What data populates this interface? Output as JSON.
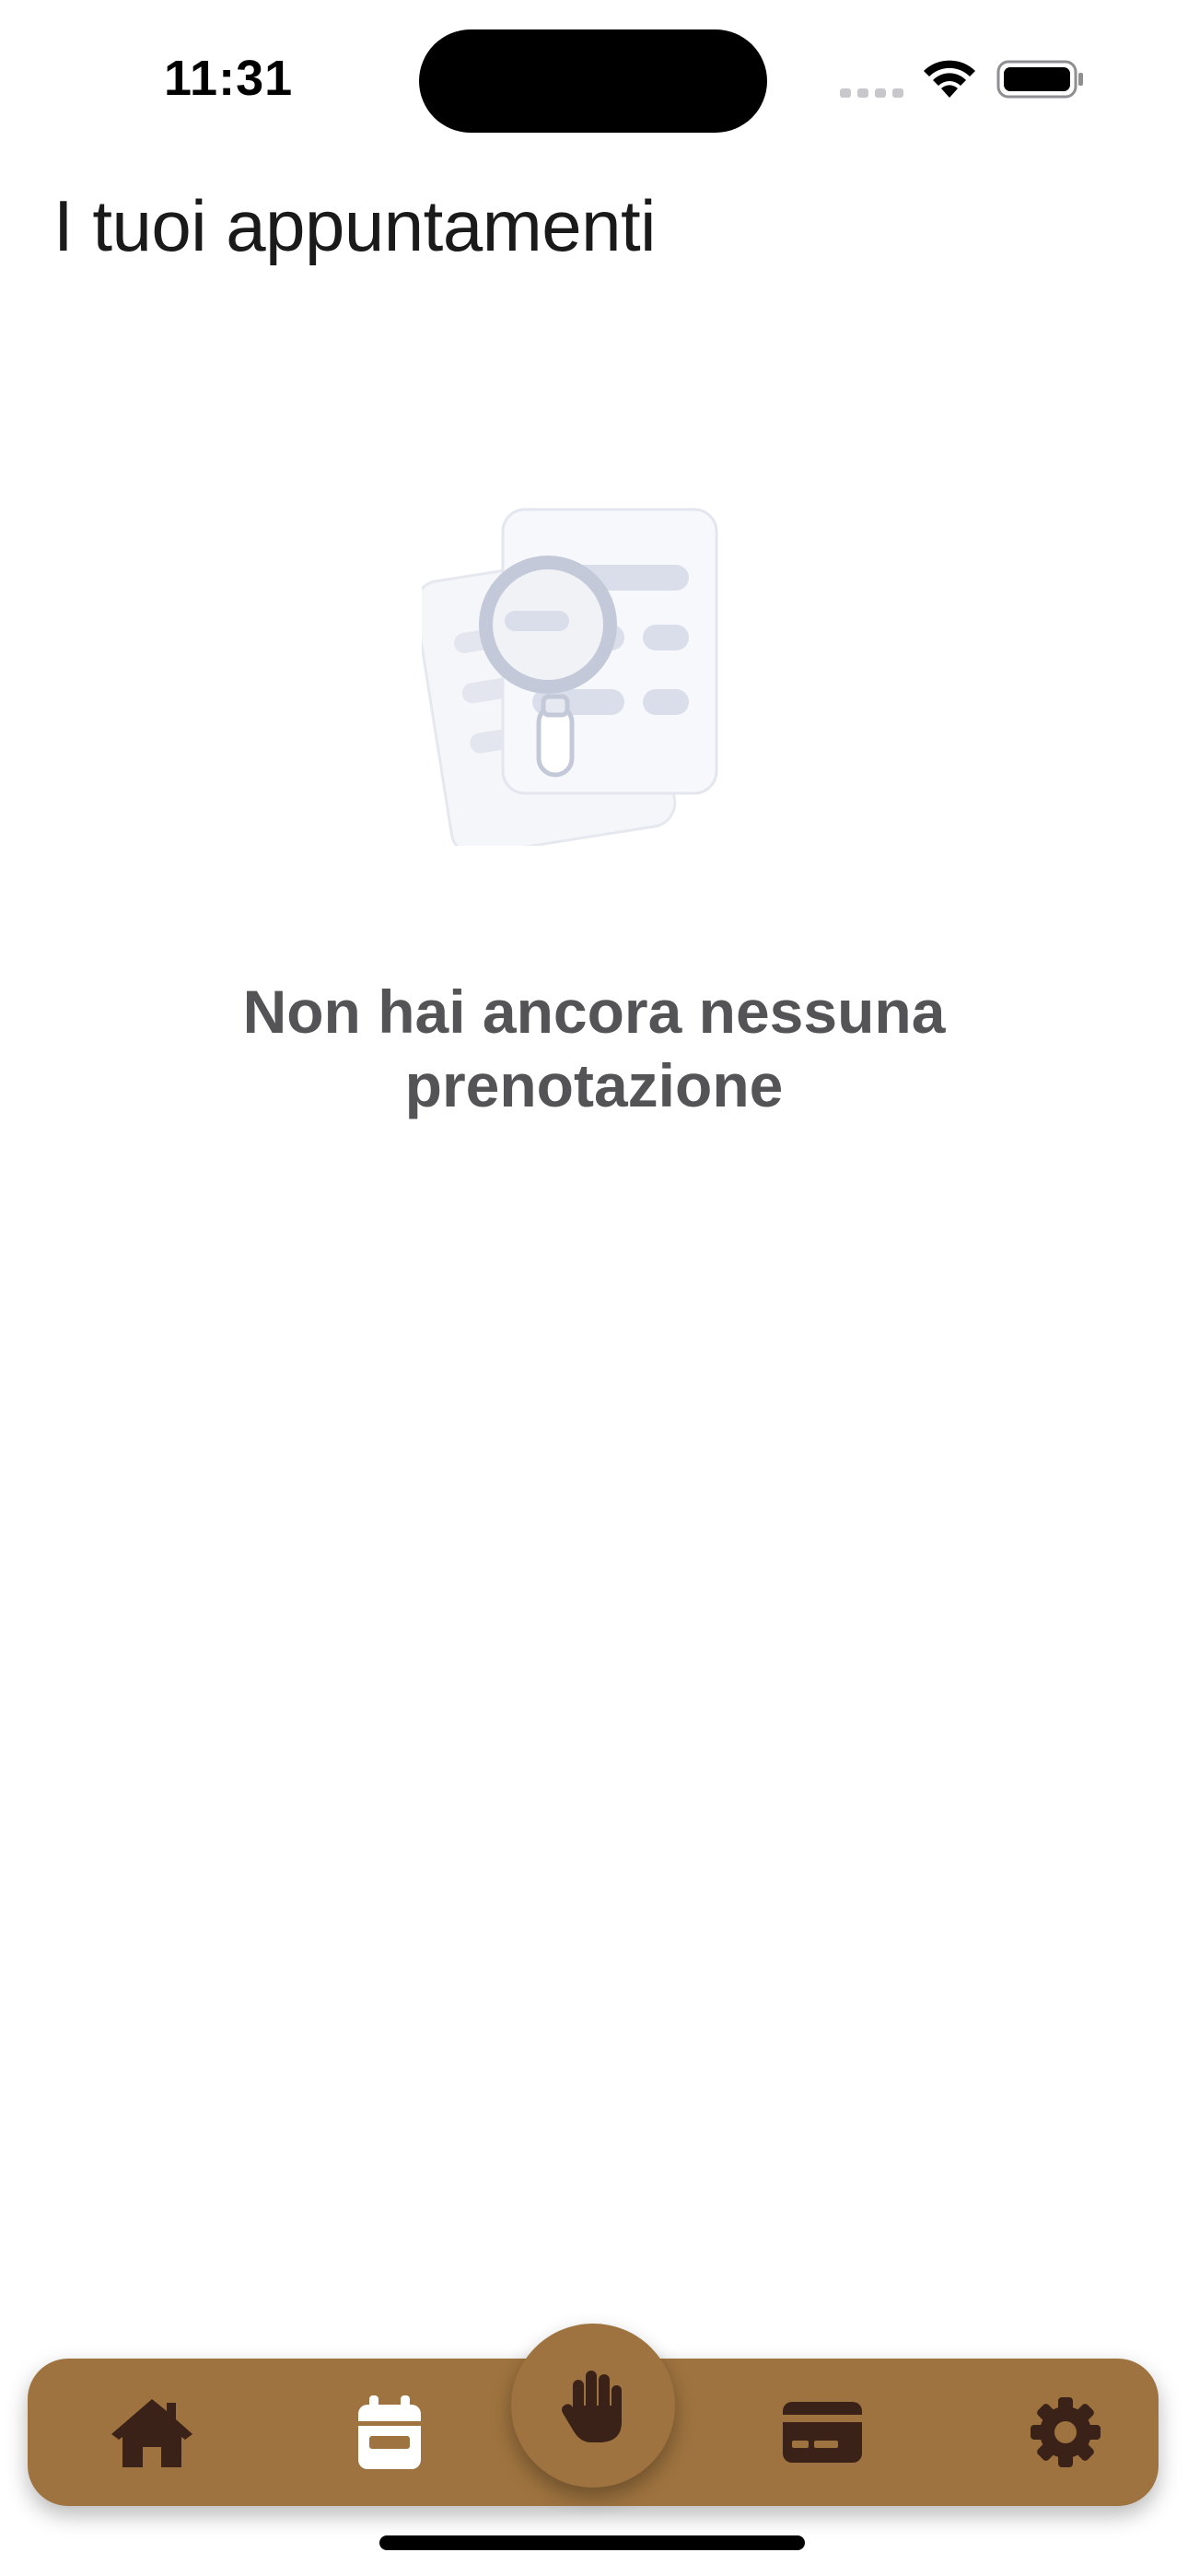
{
  "status_bar": {
    "time": "11:31",
    "icons": [
      "cell-signal-icon",
      "wifi-icon",
      "battery-icon"
    ]
  },
  "header": {
    "title": "I tuoi appuntamenti"
  },
  "empty_state": {
    "icon": "magnifier-documents-icon",
    "message": "Non hai ancora nessuna prenotazione"
  },
  "tab_bar": {
    "background_color": "#9e733f",
    "icon_color": "#3a2218",
    "active_icon_color": "#ffffff",
    "items": [
      {
        "icon": "home-icon",
        "active": false
      },
      {
        "icon": "calendar-icon",
        "active": true
      },
      {
        "icon": "hand-icon",
        "active": false,
        "center": true
      },
      {
        "icon": "credit-card-icon",
        "active": false
      },
      {
        "icon": "gear-icon",
        "active": false
      }
    ]
  }
}
